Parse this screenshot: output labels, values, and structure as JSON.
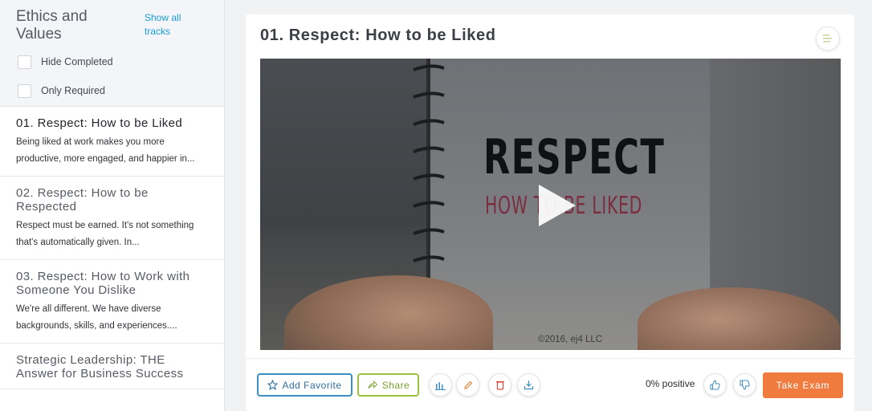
{
  "sidebar": {
    "track_title": "Ethics and Values",
    "show_all": "Show all tracks",
    "filters": [
      {
        "label": "Hide Completed",
        "checked": false
      },
      {
        "label": "Only Required",
        "checked": false
      }
    ],
    "lessons": [
      {
        "title": "01. Respect: How to be Liked",
        "desc": "Being liked at work makes you more productive, more engaged, and happier in...",
        "active": true
      },
      {
        "title": "02. Respect: How to be Respected",
        "desc": "Respect must be earned. It's not something that's automatically given. In...",
        "active": false
      },
      {
        "title": "03. Respect: How to Work with Someone You Dislike",
        "desc": "We're all different. We have diverse backgrounds, skills, and experiences....",
        "active": false
      },
      {
        "title": "Strategic Leadership: THE Answer for Business Success",
        "desc": "",
        "active": false
      }
    ]
  },
  "main": {
    "title": "01. Respect: How to be Liked",
    "video": {
      "headline": "RESPECT",
      "subline": "HOW TO BE LIKED",
      "copyright": "©2016, ej4 LLC"
    },
    "actions": {
      "favorite_label": "Add Favorite",
      "share_label": "Share",
      "positive_text": "0% positive",
      "exam_label": "Take Exam"
    }
  },
  "colors": {
    "accent_blue": "#3c8fc2",
    "accent_green": "#9cc23c",
    "exam_orange": "#f07b3f",
    "link": "#1a9bd7"
  }
}
